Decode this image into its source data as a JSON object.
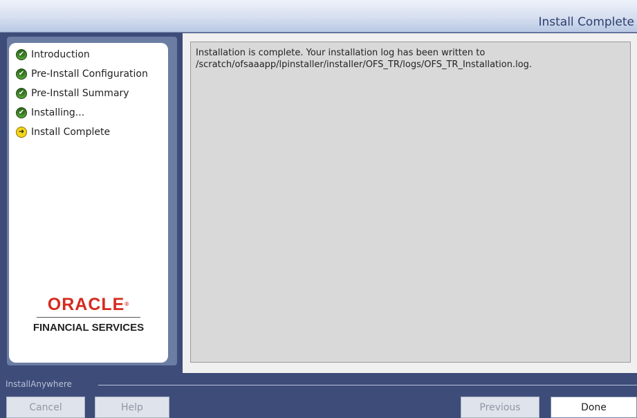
{
  "header": {
    "title": "Install Complete"
  },
  "steps": [
    {
      "label": "Introduction",
      "status": "done"
    },
    {
      "label": "Pre-Install Configuration",
      "status": "done"
    },
    {
      "label": "Pre-Install Summary",
      "status": "done"
    },
    {
      "label": "Installing...",
      "status": "done"
    },
    {
      "label": "Install Complete",
      "status": "current"
    }
  ],
  "logo": {
    "brand": "ORACLE",
    "registered_mark": "®",
    "subtitle": "FINANCIAL SERVICES"
  },
  "content": {
    "line1": "Installation is complete.  Your installation log has been written to",
    "line2": "/scratch/ofsaaapp/lpinstaller/installer/OFS_TR/logs/OFS_TR_Installation.log."
  },
  "footer": {
    "brand": "InstallAnywhere",
    "buttons": {
      "cancel": "Cancel",
      "help": "Help",
      "previous": "Previous",
      "done": "Done"
    }
  },
  "colors": {
    "window_bg": "#3d4c78",
    "accent_red": "#d52b1e",
    "done_icon": "#2f6b1d",
    "current_icon": "#f3d71a"
  }
}
